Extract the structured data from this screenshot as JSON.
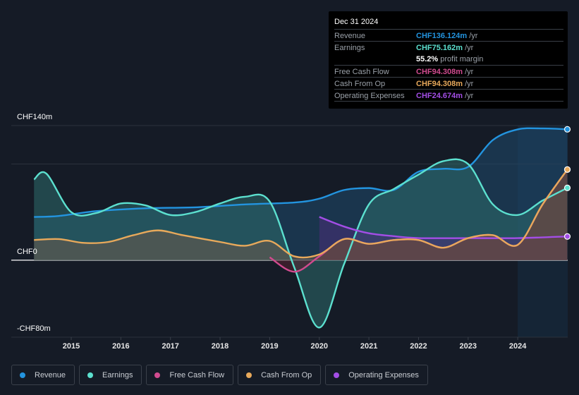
{
  "tooltip": {
    "date": "Dec 31 2024",
    "rows": [
      {
        "label": "Revenue",
        "value": "CHF136.124m",
        "unit": " /yr",
        "color": "#2394df"
      },
      {
        "label": "Earnings",
        "value": "CHF75.162m",
        "unit": " /yr",
        "color": "#5ce0cf"
      },
      {
        "label": "",
        "value": "55.2%",
        "unit": " profit margin",
        "color": "#ffffff"
      },
      {
        "label": "Free Cash Flow",
        "value": "CHF94.308m",
        "unit": " /yr",
        "color": "#d14b8f"
      },
      {
        "label": "Cash From Op",
        "value": "CHF94.308m",
        "unit": " /yr",
        "color": "#e8a95b"
      },
      {
        "label": "Operating Expenses",
        "value": "CHF24.674m",
        "unit": " /yr",
        "color": "#a34ee6"
      }
    ]
  },
  "legend": [
    {
      "label": "Revenue",
      "color": "#2394df"
    },
    {
      "label": "Earnings",
      "color": "#5ce0cf"
    },
    {
      "label": "Free Cash Flow",
      "color": "#d14b8f"
    },
    {
      "label": "Cash From Op",
      "color": "#e8a95b"
    },
    {
      "label": "Operating Expenses",
      "color": "#a34ee6"
    }
  ],
  "chart_data": {
    "type": "area",
    "title": "",
    "xlabel": "",
    "ylabel": "",
    "ylim": [
      -80,
      140
    ],
    "xlim": [
      2014.25,
      2025.0
    ],
    "highlight_from": 2024.0,
    "y_tick_labels": [
      {
        "value": 140,
        "label": "CHF140m"
      },
      {
        "value": 0,
        "label": "CHF0"
      },
      {
        "value": -80,
        "label": "-CHF80m"
      }
    ],
    "gridlines": [
      140,
      100,
      0
    ],
    "x_ticks": [
      2015,
      2016,
      2017,
      2018,
      2019,
      2020,
      2021,
      2022,
      2023,
      2024
    ],
    "legend_position": "bottom",
    "series": [
      {
        "name": "Revenue",
        "color": "#2394df",
        "x": [
          2014.25,
          2014.75,
          2015.5,
          2016.5,
          2017.5,
          2018.5,
          2019.5,
          2020.0,
          2020.5,
          2021.0,
          2021.5,
          2022.0,
          2022.5,
          2023.0,
          2023.5,
          2024.0,
          2024.5,
          2025.0
        ],
        "values": [
          45,
          46,
          51,
          54,
          55,
          58,
          60,
          64,
          73,
          75,
          73,
          92,
          95,
          97,
          125,
          136,
          137,
          136.1
        ]
      },
      {
        "name": "Earnings",
        "color": "#5ce0cf",
        "x": [
          2014.25,
          2014.5,
          2015.0,
          2015.5,
          2016.0,
          2016.5,
          2017.0,
          2017.5,
          2018.0,
          2018.5,
          2019.0,
          2019.5,
          2020.0,
          2020.5,
          2021.0,
          2021.5,
          2022.0,
          2022.5,
          2023.0,
          2023.5,
          2024.0,
          2024.5,
          2025.0
        ],
        "values": [
          84,
          90,
          50,
          49,
          59,
          57,
          47,
          50,
          59,
          66,
          61,
          -8,
          -70,
          -4,
          58,
          74,
          89,
          103,
          100,
          58,
          47,
          62,
          75.2
        ]
      },
      {
        "name": "Free Cash Flow",
        "color": "#d14b8f",
        "x": [
          2019.0,
          2019.5,
          2020.0,
          2020.5,
          2021.0,
          2021.5,
          2022.0,
          2022.5,
          2023.0,
          2023.5,
          2024.0,
          2024.5,
          2025.0
        ],
        "values": [
          3,
          -12,
          4,
          22,
          17,
          21,
          21,
          13,
          23,
          26,
          16,
          58,
          94.3
        ]
      },
      {
        "name": "Cash From Op",
        "color": "#e8a95b",
        "x": [
          2014.25,
          2014.75,
          2015.25,
          2015.75,
          2016.25,
          2016.75,
          2017.25,
          2018.0,
          2018.5,
          2019.0,
          2019.5,
          2020.0,
          2020.5,
          2021.0,
          2021.5,
          2022.0,
          2022.5,
          2023.0,
          2023.5,
          2024.0,
          2024.5,
          2025.0
        ],
        "values": [
          21,
          22,
          18,
          19,
          26,
          31,
          26,
          19,
          15,
          20,
          4,
          6,
          22,
          17,
          21,
          21,
          13,
          23,
          26,
          16,
          58,
          94.3
        ]
      },
      {
        "name": "Operating Expenses",
        "color": "#a34ee6",
        "x": [
          2020.0,
          2020.5,
          2021.0,
          2021.5,
          2022.0,
          2023.0,
          2024.0,
          2025.0
        ],
        "values": [
          45,
          35,
          28,
          25,
          23,
          23,
          23,
          24.7
        ]
      }
    ]
  }
}
